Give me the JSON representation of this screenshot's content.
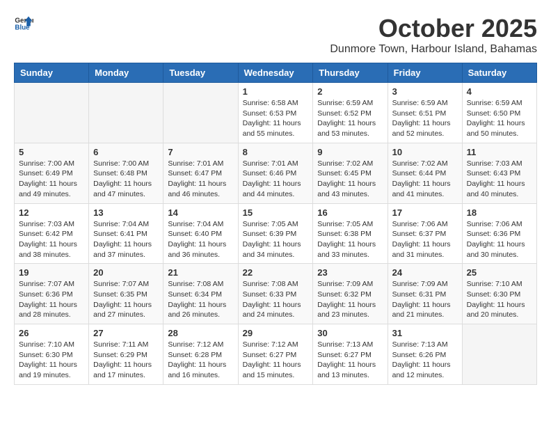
{
  "header": {
    "logo_general": "General",
    "logo_blue": "Blue",
    "month": "October 2025",
    "location": "Dunmore Town, Harbour Island, Bahamas"
  },
  "days_of_week": [
    "Sunday",
    "Monday",
    "Tuesday",
    "Wednesday",
    "Thursday",
    "Friday",
    "Saturday"
  ],
  "weeks": [
    [
      {
        "day": "",
        "sunrise": "",
        "sunset": "",
        "daylight": ""
      },
      {
        "day": "",
        "sunrise": "",
        "sunset": "",
        "daylight": ""
      },
      {
        "day": "",
        "sunrise": "",
        "sunset": "",
        "daylight": ""
      },
      {
        "day": "1",
        "sunrise": "Sunrise: 6:58 AM",
        "sunset": "Sunset: 6:53 PM",
        "daylight": "Daylight: 11 hours and 55 minutes."
      },
      {
        "day": "2",
        "sunrise": "Sunrise: 6:59 AM",
        "sunset": "Sunset: 6:52 PM",
        "daylight": "Daylight: 11 hours and 53 minutes."
      },
      {
        "day": "3",
        "sunrise": "Sunrise: 6:59 AM",
        "sunset": "Sunset: 6:51 PM",
        "daylight": "Daylight: 11 hours and 52 minutes."
      },
      {
        "day": "4",
        "sunrise": "Sunrise: 6:59 AM",
        "sunset": "Sunset: 6:50 PM",
        "daylight": "Daylight: 11 hours and 50 minutes."
      }
    ],
    [
      {
        "day": "5",
        "sunrise": "Sunrise: 7:00 AM",
        "sunset": "Sunset: 6:49 PM",
        "daylight": "Daylight: 11 hours and 49 minutes."
      },
      {
        "day": "6",
        "sunrise": "Sunrise: 7:00 AM",
        "sunset": "Sunset: 6:48 PM",
        "daylight": "Daylight: 11 hours and 47 minutes."
      },
      {
        "day": "7",
        "sunrise": "Sunrise: 7:01 AM",
        "sunset": "Sunset: 6:47 PM",
        "daylight": "Daylight: 11 hours and 46 minutes."
      },
      {
        "day": "8",
        "sunrise": "Sunrise: 7:01 AM",
        "sunset": "Sunset: 6:46 PM",
        "daylight": "Daylight: 11 hours and 44 minutes."
      },
      {
        "day": "9",
        "sunrise": "Sunrise: 7:02 AM",
        "sunset": "Sunset: 6:45 PM",
        "daylight": "Daylight: 11 hours and 43 minutes."
      },
      {
        "day": "10",
        "sunrise": "Sunrise: 7:02 AM",
        "sunset": "Sunset: 6:44 PM",
        "daylight": "Daylight: 11 hours and 41 minutes."
      },
      {
        "day": "11",
        "sunrise": "Sunrise: 7:03 AM",
        "sunset": "Sunset: 6:43 PM",
        "daylight": "Daylight: 11 hours and 40 minutes."
      }
    ],
    [
      {
        "day": "12",
        "sunrise": "Sunrise: 7:03 AM",
        "sunset": "Sunset: 6:42 PM",
        "daylight": "Daylight: 11 hours and 38 minutes."
      },
      {
        "day": "13",
        "sunrise": "Sunrise: 7:04 AM",
        "sunset": "Sunset: 6:41 PM",
        "daylight": "Daylight: 11 hours and 37 minutes."
      },
      {
        "day": "14",
        "sunrise": "Sunrise: 7:04 AM",
        "sunset": "Sunset: 6:40 PM",
        "daylight": "Daylight: 11 hours and 36 minutes."
      },
      {
        "day": "15",
        "sunrise": "Sunrise: 7:05 AM",
        "sunset": "Sunset: 6:39 PM",
        "daylight": "Daylight: 11 hours and 34 minutes."
      },
      {
        "day": "16",
        "sunrise": "Sunrise: 7:05 AM",
        "sunset": "Sunset: 6:38 PM",
        "daylight": "Daylight: 11 hours and 33 minutes."
      },
      {
        "day": "17",
        "sunrise": "Sunrise: 7:06 AM",
        "sunset": "Sunset: 6:37 PM",
        "daylight": "Daylight: 11 hours and 31 minutes."
      },
      {
        "day": "18",
        "sunrise": "Sunrise: 7:06 AM",
        "sunset": "Sunset: 6:36 PM",
        "daylight": "Daylight: 11 hours and 30 minutes."
      }
    ],
    [
      {
        "day": "19",
        "sunrise": "Sunrise: 7:07 AM",
        "sunset": "Sunset: 6:36 PM",
        "daylight": "Daylight: 11 hours and 28 minutes."
      },
      {
        "day": "20",
        "sunrise": "Sunrise: 7:07 AM",
        "sunset": "Sunset: 6:35 PM",
        "daylight": "Daylight: 11 hours and 27 minutes."
      },
      {
        "day": "21",
        "sunrise": "Sunrise: 7:08 AM",
        "sunset": "Sunset: 6:34 PM",
        "daylight": "Daylight: 11 hours and 26 minutes."
      },
      {
        "day": "22",
        "sunrise": "Sunrise: 7:08 AM",
        "sunset": "Sunset: 6:33 PM",
        "daylight": "Daylight: 11 hours and 24 minutes."
      },
      {
        "day": "23",
        "sunrise": "Sunrise: 7:09 AM",
        "sunset": "Sunset: 6:32 PM",
        "daylight": "Daylight: 11 hours and 23 minutes."
      },
      {
        "day": "24",
        "sunrise": "Sunrise: 7:09 AM",
        "sunset": "Sunset: 6:31 PM",
        "daylight": "Daylight: 11 hours and 21 minutes."
      },
      {
        "day": "25",
        "sunrise": "Sunrise: 7:10 AM",
        "sunset": "Sunset: 6:30 PM",
        "daylight": "Daylight: 11 hours and 20 minutes."
      }
    ],
    [
      {
        "day": "26",
        "sunrise": "Sunrise: 7:10 AM",
        "sunset": "Sunset: 6:30 PM",
        "daylight": "Daylight: 11 hours and 19 minutes."
      },
      {
        "day": "27",
        "sunrise": "Sunrise: 7:11 AM",
        "sunset": "Sunset: 6:29 PM",
        "daylight": "Daylight: 11 hours and 17 minutes."
      },
      {
        "day": "28",
        "sunrise": "Sunrise: 7:12 AM",
        "sunset": "Sunset: 6:28 PM",
        "daylight": "Daylight: 11 hours and 16 minutes."
      },
      {
        "day": "29",
        "sunrise": "Sunrise: 7:12 AM",
        "sunset": "Sunset: 6:27 PM",
        "daylight": "Daylight: 11 hours and 15 minutes."
      },
      {
        "day": "30",
        "sunrise": "Sunrise: 7:13 AM",
        "sunset": "Sunset: 6:27 PM",
        "daylight": "Daylight: 11 hours and 13 minutes."
      },
      {
        "day": "31",
        "sunrise": "Sunrise: 7:13 AM",
        "sunset": "Sunset: 6:26 PM",
        "daylight": "Daylight: 11 hours and 12 minutes."
      },
      {
        "day": "",
        "sunrise": "",
        "sunset": "",
        "daylight": ""
      }
    ]
  ]
}
